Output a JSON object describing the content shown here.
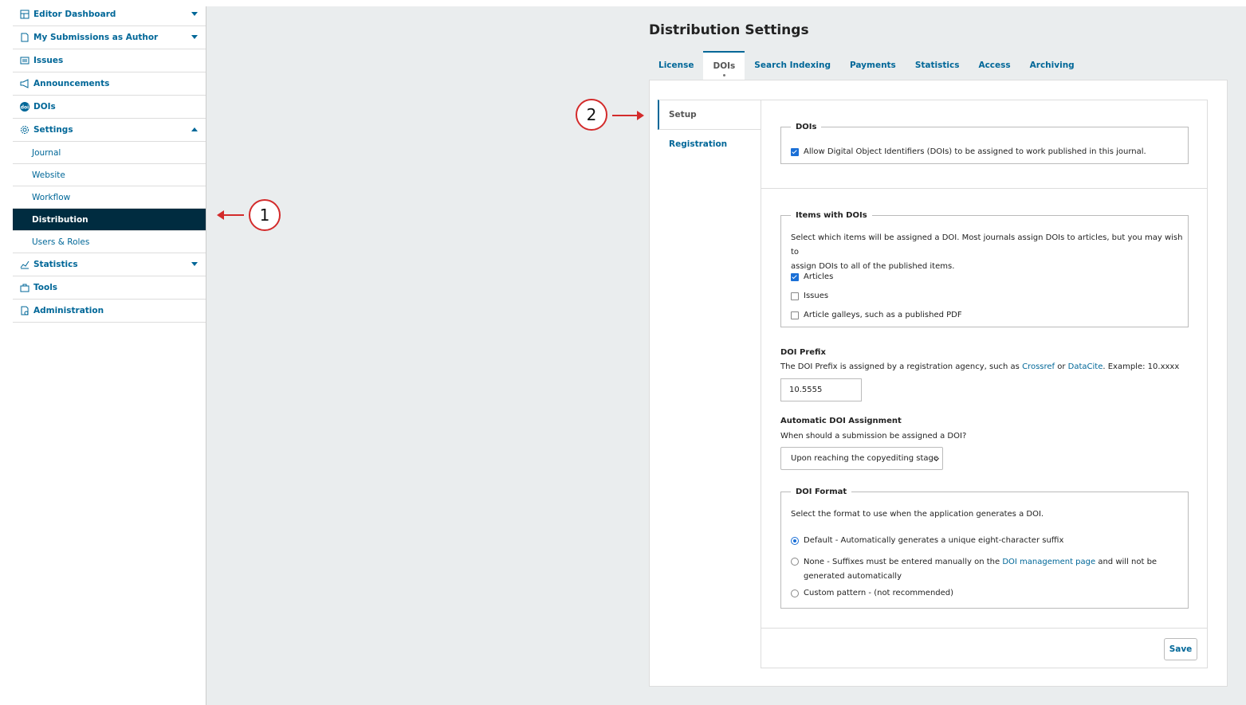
{
  "sidebar": {
    "items": [
      {
        "label": "Editor Dashboard",
        "icon": "dashboard-icon"
      },
      {
        "label": "My Submissions as Author",
        "icon": "document-icon"
      },
      {
        "label": "Issues",
        "icon": "issues-icon"
      },
      {
        "label": "Announcements",
        "icon": "megaphone-icon"
      },
      {
        "label": "DOIs",
        "icon": "doi-icon"
      },
      {
        "label": "Settings",
        "icon": "gear-icon"
      },
      {
        "label": "Statistics",
        "icon": "chart-icon"
      },
      {
        "label": "Tools",
        "icon": "toolbox-icon"
      },
      {
        "label": "Administration",
        "icon": "admin-icon"
      }
    ],
    "settings_subitems": [
      {
        "label": "Journal"
      },
      {
        "label": "Website"
      },
      {
        "label": "Workflow"
      },
      {
        "label": "Distribution"
      },
      {
        "label": "Users & Roles"
      }
    ]
  },
  "page": {
    "title": "Distribution Settings",
    "tabs": [
      {
        "label": "License"
      },
      {
        "label": "DOIs"
      },
      {
        "label": "Search Indexing"
      },
      {
        "label": "Payments"
      },
      {
        "label": "Statistics"
      },
      {
        "label": "Access"
      },
      {
        "label": "Archiving"
      }
    ]
  },
  "subnav": {
    "items": [
      {
        "label": "Setup"
      },
      {
        "label": "Registration"
      }
    ]
  },
  "form": {
    "dois_legend": "DOIs",
    "allow_dois_label": "Allow Digital Object Identifiers (DOIs) to be assigned to work published in this journal.",
    "items_legend": "Items with DOIs",
    "items_desc_1": "Select which items will be assigned a DOI. Most journals assign DOIs to articles, but you may wish to",
    "items_desc_2": "assign DOIs to all of the published items.",
    "items": [
      {
        "label": "Articles",
        "checked": true
      },
      {
        "label": "Issues",
        "checked": false
      },
      {
        "label": "Article galleys, such as a published PDF",
        "checked": false
      }
    ],
    "prefix_label": "DOI Prefix",
    "prefix_desc_1": "The DOI Prefix is assigned by a registration agency, such as ",
    "prefix_link_crossref": "Crossref",
    "prefix_desc_or": " or ",
    "prefix_link_datacite": "DataCite",
    "prefix_desc_2": ". Example: 10.xxxx",
    "prefix_value": "10.5555",
    "auto_label": "Automatic DOI Assignment",
    "auto_desc": "When should a submission be assigned a DOI?",
    "auto_value": "Upon reaching the copyediting stage",
    "format_legend": "DOI Format",
    "format_desc": "Select the format to use when the application generates a DOI.",
    "format_default": "Default - Automatically generates a unique eight-character suffix",
    "format_none_1": "None - Suffixes must be entered manually on the ",
    "format_none_link": "DOI management page",
    "format_none_2": " and will not be",
    "format_none_3": "generated automatically",
    "format_custom": "Custom pattern - (not recommended)",
    "save_label": "Save"
  },
  "callouts": {
    "one": "1",
    "two": "2"
  },
  "colors": {
    "accent": "#006798",
    "active_nav": "#002c40",
    "callout": "#d32b2b"
  }
}
